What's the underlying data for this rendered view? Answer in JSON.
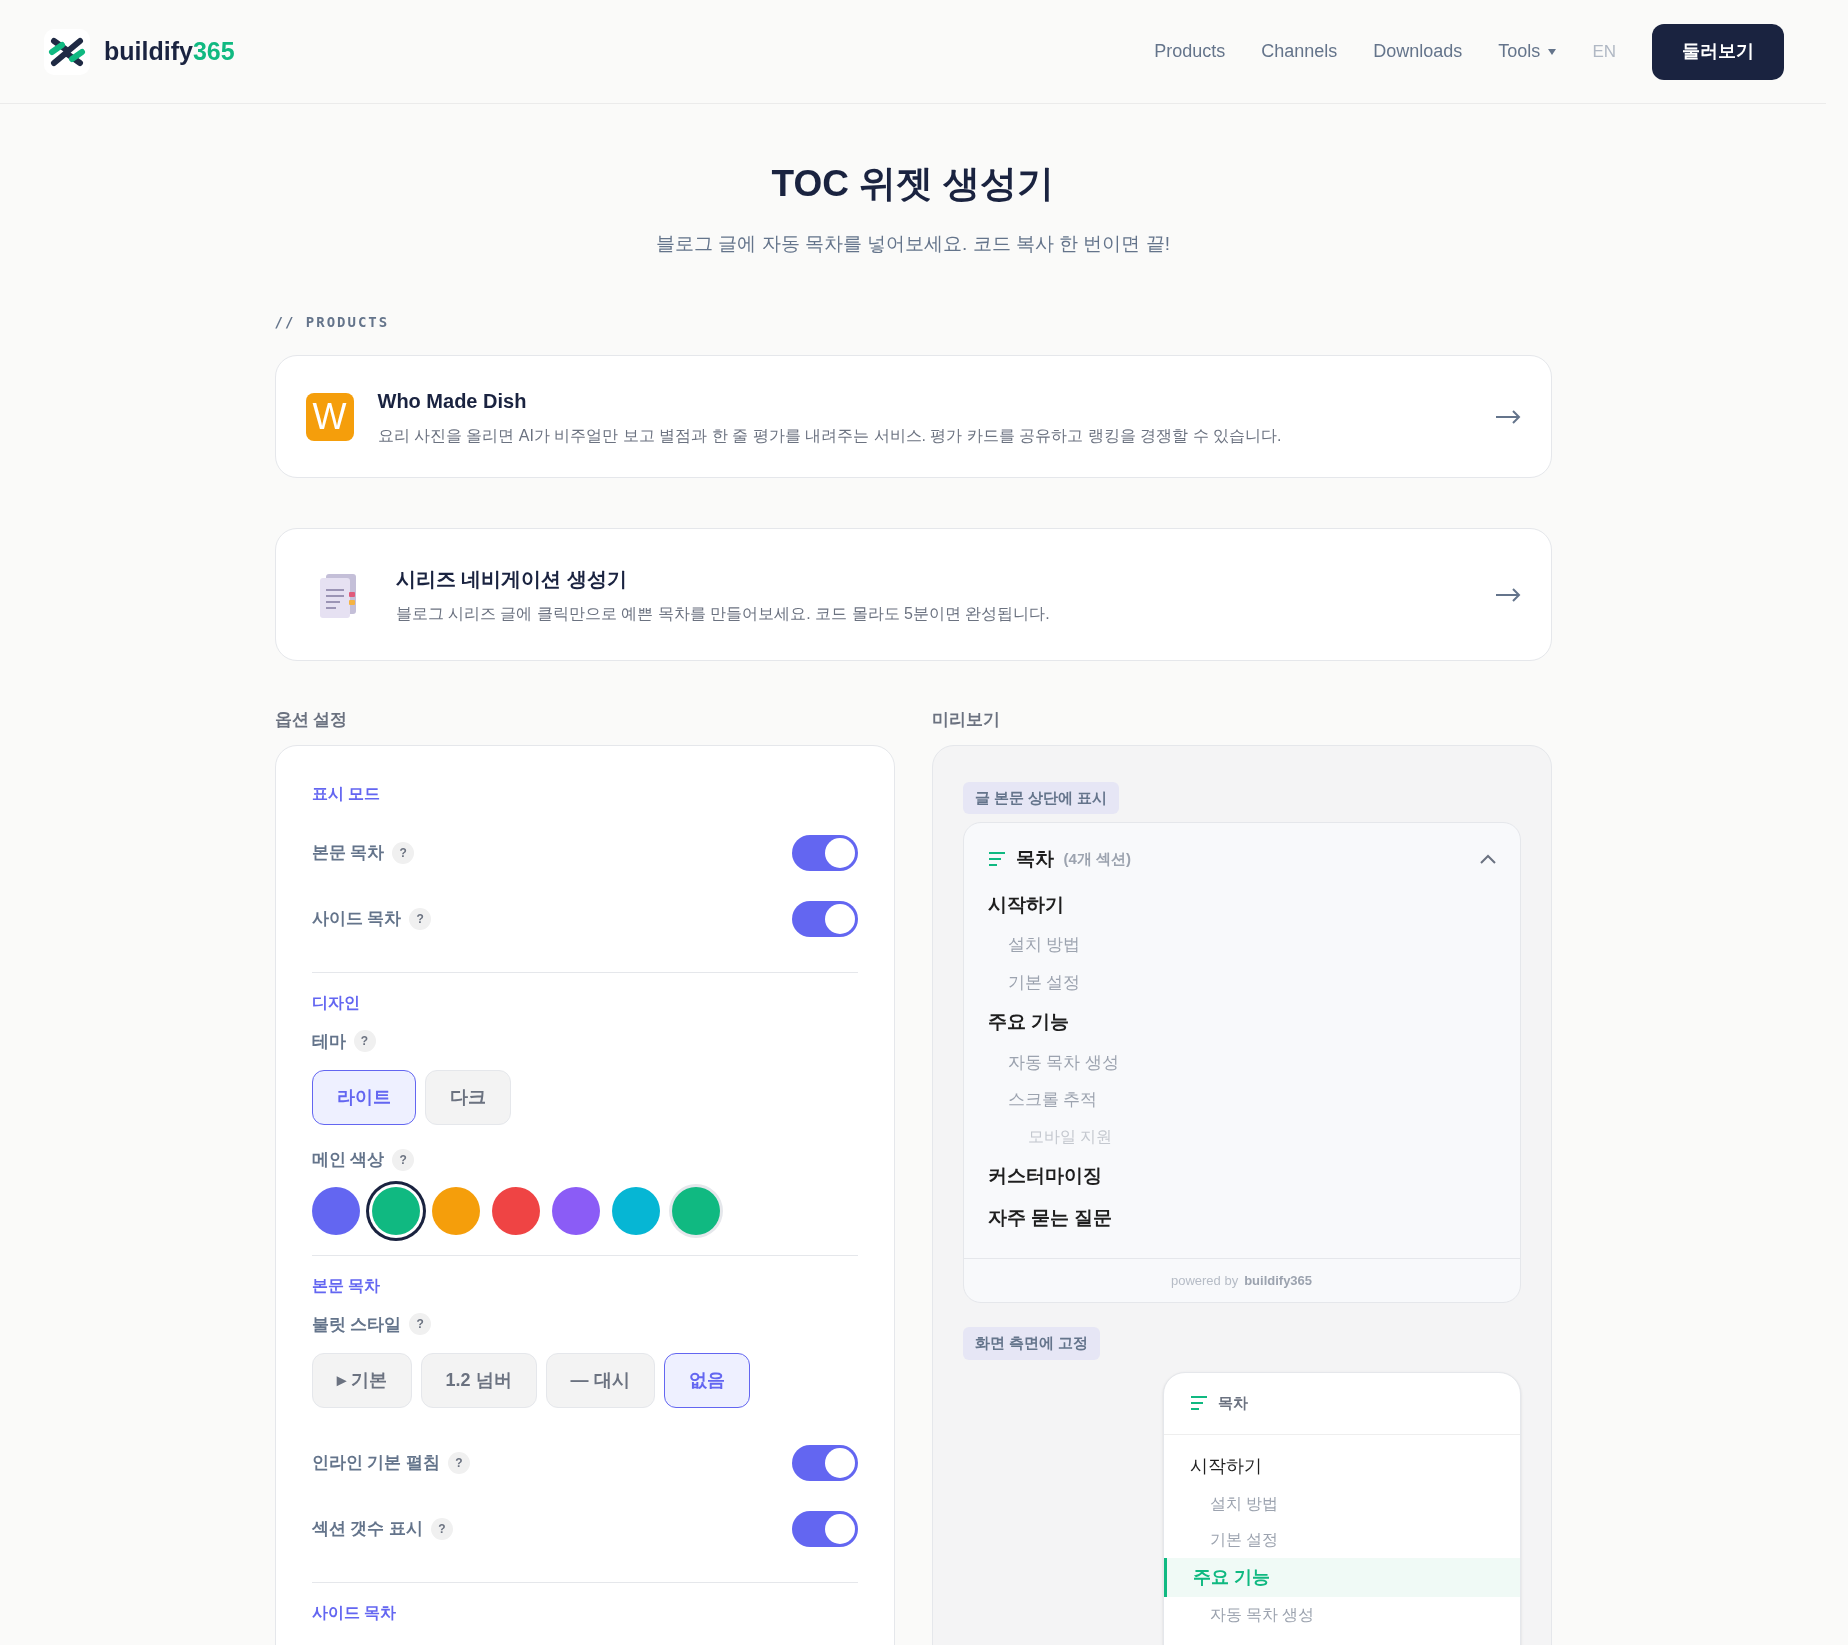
{
  "header": {
    "logo_text": "buildify",
    "logo_suffix": "365",
    "nav": [
      {
        "label": "Products",
        "dropdown": false
      },
      {
        "label": "Channels",
        "dropdown": false
      },
      {
        "label": "Downloads",
        "dropdown": false
      },
      {
        "label": "Tools",
        "dropdown": true
      }
    ],
    "language": "EN",
    "cta": "둘러보기"
  },
  "page": {
    "title": "TOC 위젯 생성기",
    "subtitle": "블로그 글에 자동 목차를 넣어보세요. 코드 복사 한 번이면 끝!"
  },
  "products": {
    "heading": "// PRODUCTS",
    "items": [
      {
        "kind": "letter",
        "icon_text": "W",
        "title": "Who Made Dish",
        "description": "요리 사진을 올리면 AI가 비주얼만 보고 별점과 한 줄 평가를 내려주는 서비스. 평가 카드를 공유하고 랭킹을 경쟁할 수 있습니다."
      },
      {
        "kind": "document",
        "title": "시리즈 네비게이션 생성기",
        "description": "블로그 시리즈 글에 클릭만으로 예쁜 목차를 만들어보세요. 코드 몰라도 5분이면 완성됩니다."
      }
    ]
  },
  "options": {
    "heading": "옵션 설정",
    "sections": [
      {
        "title": "표시 모드",
        "rows": [
          {
            "kind": "toggle",
            "label": "본문 목차",
            "help": "?",
            "on": true
          },
          {
            "kind": "toggle",
            "label": "사이드 목차",
            "help": "?",
            "on": true
          }
        ]
      },
      {
        "title": "디자인",
        "rows": [
          {
            "kind": "segmented",
            "label": "테마",
            "help": "?",
            "options": [
              {
                "label": "라이트",
                "selected": true
              },
              {
                "label": "다크",
                "selected": false
              }
            ]
          },
          {
            "kind": "swatches",
            "label": "메인 색상",
            "help": "?",
            "swatches": [
              {
                "kind": "preset",
                "color": "#6366f1",
                "selected": false
              },
              {
                "kind": "preset",
                "color": "#10b981",
                "selected": true
              },
              {
                "kind": "preset",
                "color": "#f59e0b",
                "selected": false
              },
              {
                "kind": "preset",
                "color": "#ef4444",
                "selected": false
              },
              {
                "kind": "preset",
                "color": "#8b5cf6",
                "selected": false
              },
              {
                "kind": "preset",
                "color": "#06b6d4",
                "selected": false
              },
              {
                "kind": "custom",
                "color": "#10b981",
                "selected": false
              }
            ]
          }
        ]
      },
      {
        "title": "본문 목차",
        "rows": [
          {
            "kind": "segmented",
            "label": "불릿 스타일",
            "help": "?",
            "options": [
              {
                "label": "▸ 기본",
                "selected": false
              },
              {
                "label": "1.2 넘버",
                "selected": false
              },
              {
                "label": "— 대시",
                "selected": false
              },
              {
                "label": "없음",
                "selected": true
              }
            ]
          },
          {
            "kind": "toggle",
            "label": "인라인 기본 펼침",
            "help": "?",
            "on": true
          },
          {
            "kind": "toggle",
            "label": "섹션 갯수 표시",
            "help": "?",
            "on": true
          }
        ]
      },
      {
        "title": "사이드 목차"
      }
    ]
  },
  "preview": {
    "heading": "미리보기",
    "inline": {
      "badge": "글 본문 상단에 표시",
      "title": "목차",
      "count": "(4개 섹션)",
      "expanded": true,
      "items": [
        {
          "label": "시작하기",
          "children": [
            {
              "label": "설치 방법"
            },
            {
              "label": "기본 설정"
            }
          ]
        },
        {
          "label": "주요 기능",
          "children": [
            {
              "label": "자동 목차 생성"
            },
            {
              "label": "스크롤 추적",
              "children": [
                {
                  "label": "모바일 지원"
                }
              ]
            }
          ]
        },
        {
          "label": "커스터마이징"
        },
        {
          "label": "자주 묻는 질문"
        }
      ],
      "footer_prefix": "powered by",
      "footer_brand": "buildify365"
    },
    "side": {
      "badge": "화면 측면에 고정",
      "title": "목차",
      "items": [
        {
          "label": "시작하기",
          "selected": false,
          "children": [
            {
              "label": "설치 방법",
              "selected": false
            },
            {
              "label": "기본 설정",
              "selected": false
            }
          ]
        },
        {
          "label": "주요 기능",
          "selected": true,
          "children": [
            {
              "label": "자동 목차 생성",
              "selected": false
            }
          ]
        }
      ]
    }
  }
}
